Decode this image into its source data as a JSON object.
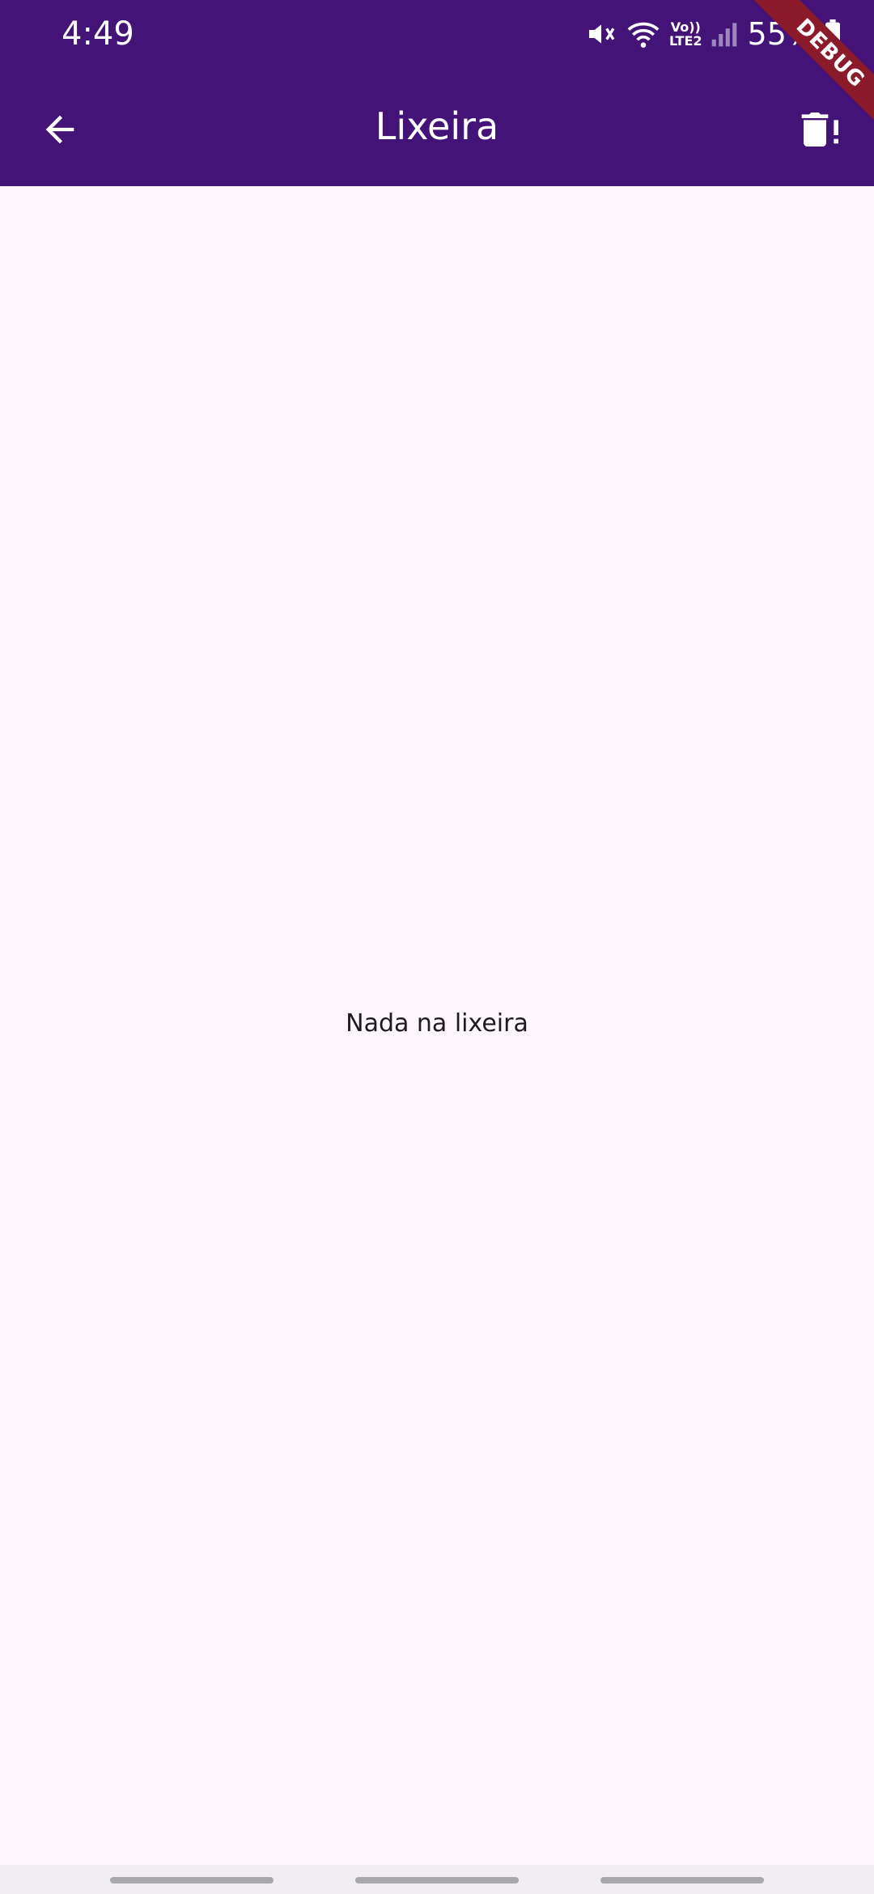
{
  "status_bar": {
    "time": "4:49",
    "lte_top": "Vo))",
    "lte_bottom": "LTE2",
    "battery_percent": "55%",
    "icons": [
      "mute-icon",
      "wifi-icon",
      "volte-icon",
      "signal-icon",
      "battery-icon"
    ]
  },
  "app_bar": {
    "title": "Lixeira",
    "back_icon": "arrow-back-icon",
    "action_icon": "delete-forever-icon"
  },
  "debug_banner": {
    "label": "DEBUG"
  },
  "body": {
    "empty_message": "Nada na lixeira"
  },
  "colors": {
    "app_bar_bg": "#431378",
    "page_bg": "#fdf7fd",
    "debug_banner": "#8b1a2b"
  }
}
